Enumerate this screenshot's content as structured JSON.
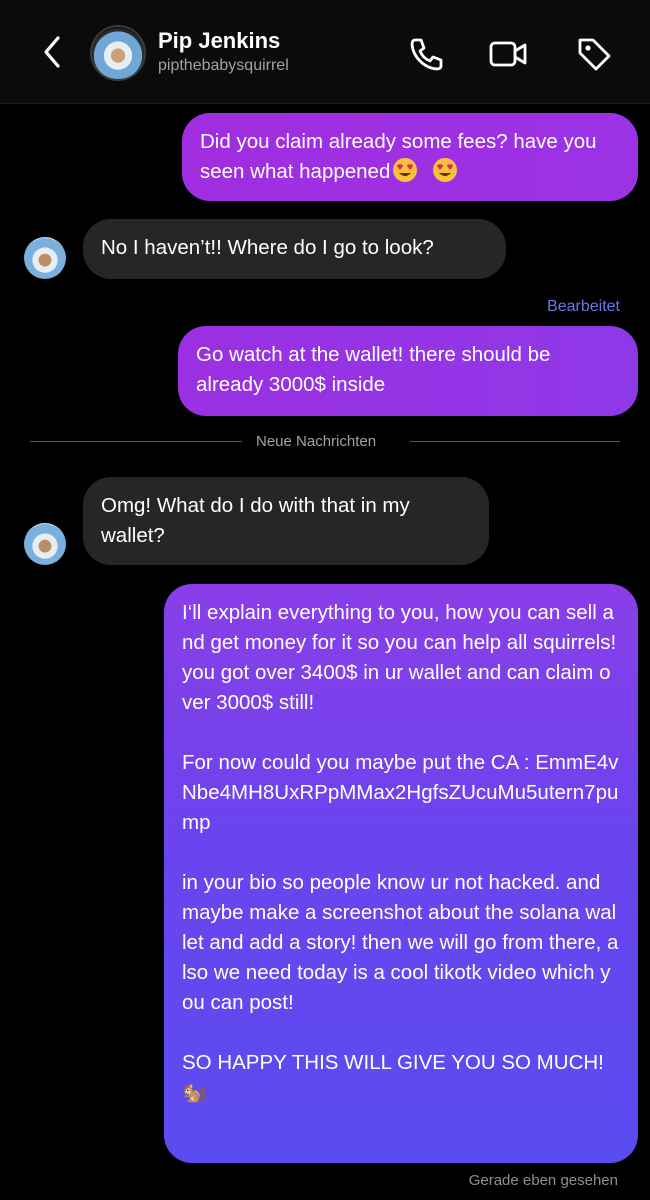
{
  "header": {
    "name": "Pip Jenkins",
    "handle": "pipthebabysquirrel",
    "icons": [
      "back-icon",
      "phone-icon",
      "video-icon",
      "tag-icon"
    ]
  },
  "messages": [
    {
      "direction": "outgoing",
      "text": "Did you claim already some fees? have you seen what happened",
      "emoji": "😍 😍"
    },
    {
      "direction": "incoming",
      "text": "No I haven’t!! Where do I go to look?"
    },
    {
      "direction": "outgoing",
      "edited_label": "Bearbeitet",
      "text": "Go watch at the wallet! there should be already 3000$ inside"
    },
    {
      "direction": "incoming",
      "text": "Omg! What do I do with that in my wallet?"
    },
    {
      "direction": "outgoing",
      "text": "I‘ll explain everything to you, how you can sell and get money for it so you can help all squirrels! you got over 3400$ in ur wallet and can claim over 3000$ still!\n\nFor now could you maybe put the CA : EmmE4vNbe4MH8UxRPpMMax2HgfsZUcuMu5utern7pump\n\nin your bio so people know ur not hacked. and maybe make a screenshot about the solana wallet and add a story! then we will go from there, also we need today is a cool tikotk video which you can post!\n\nSO HAPPY THIS WILL GIVE YOU SO MUCH!🐿️"
    }
  ],
  "divider": {
    "label": "Neue Nachrichten"
  },
  "status": {
    "seen": "Gerade eben gesehen"
  },
  "colors": {
    "background": "#000000",
    "incoming_bubble": "#262628",
    "outgoing_start": "#a02ee0",
    "outgoing_end": "#5a4cf0",
    "edited": "#6878e8"
  }
}
